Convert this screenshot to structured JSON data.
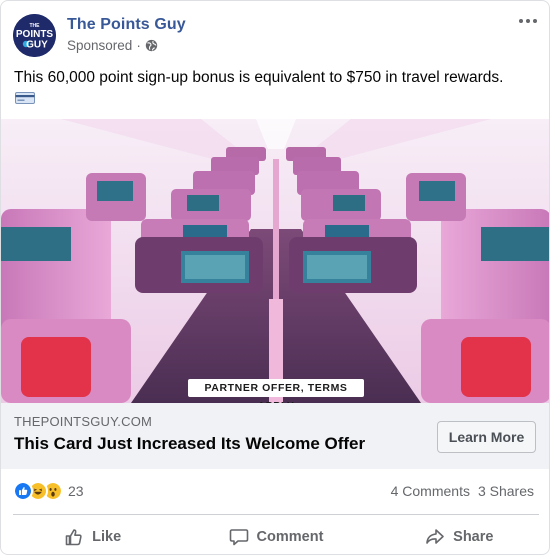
{
  "post": {
    "page_name": "The Points Guy",
    "sponsored_label": "Sponsored",
    "separator": "·",
    "more_icon": "more-options-icon",
    "caption": "This 60,000 point sign-up bonus is equivalent to $750 in travel rewards.",
    "caption_emoji": "credit-card-emoji",
    "avatar_text": [
      "THE",
      "POINTS",
      "GUY"
    ]
  },
  "ad_image": {
    "badge": "PARTNER OFFER, TERMS APPLY"
  },
  "link": {
    "domain": "THEPOINTSGUY.COM",
    "headline": "This Card Just Increased Its Welcome Offer",
    "button_label": "Learn More"
  },
  "engagement": {
    "reaction_icons": [
      "like-reaction-icon",
      "haha-reaction-icon",
      "wow-reaction-icon"
    ],
    "reaction_count": "23",
    "comments": "4 Comments",
    "shares": "3 Shares"
  },
  "actions": {
    "like": "Like",
    "comment": "Comment",
    "share": "Share"
  },
  "colors": {
    "page_name": "#385898",
    "secondary_text": "#65676b",
    "link_area_bg": "#f0f2f5",
    "like_blue": "#1877f2",
    "cabin_pink": "#e79ad0"
  }
}
